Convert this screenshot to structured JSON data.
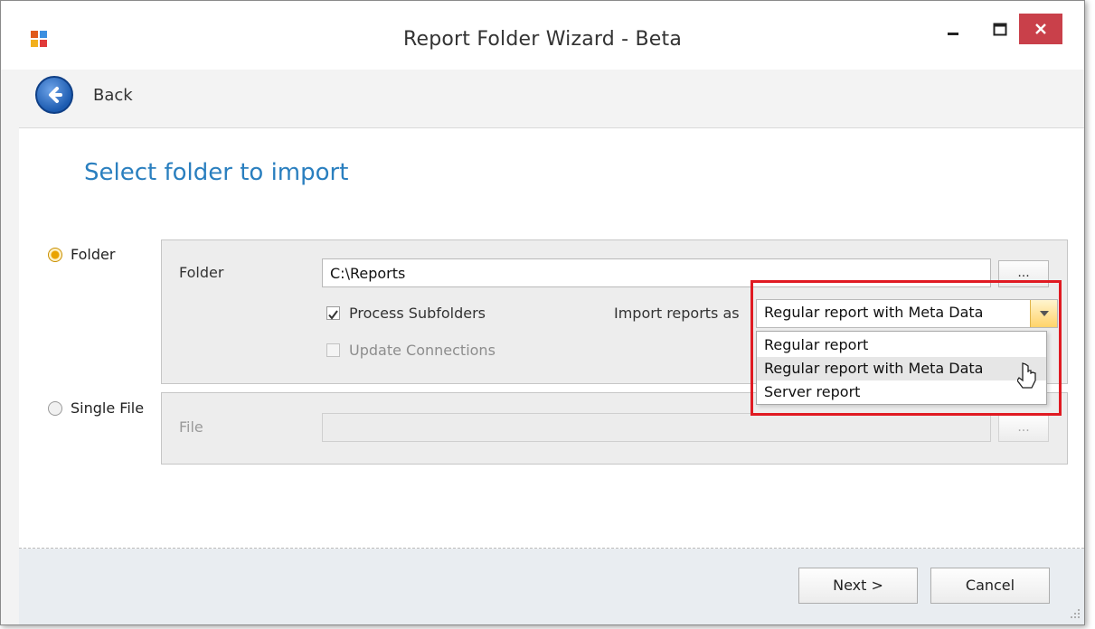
{
  "window": {
    "title": "Report Folder Wizard - Beta",
    "minimize_icon": "minimize-icon",
    "maximize_icon": "maximize-icon",
    "close_icon": "close-icon",
    "close_color": "#c9404a"
  },
  "nav": {
    "back_label": "Back"
  },
  "page": {
    "heading": "Select folder to import",
    "heading_color": "#2a7fbf"
  },
  "source_options": {
    "folder": {
      "label": "Folder",
      "checked": true
    },
    "single_file": {
      "label": "Single File",
      "checked": false
    }
  },
  "folder_group": {
    "folder_label": "Folder",
    "folder_value": "C:\\Reports",
    "browse_label": "...",
    "process_subfolders": {
      "label": "Process Subfolders",
      "checked": true
    },
    "update_connections": {
      "label": "Update Connections",
      "checked": false
    },
    "import_as_label": "Import reports as",
    "import_as_selected": "Regular report with Meta Data",
    "dropdown_options": [
      "Regular report",
      "Regular report with Meta Data",
      "Server report"
    ],
    "hovered_option": "Regular report with Meta Data"
  },
  "file_group": {
    "file_label": "File",
    "file_value": "",
    "browse_label": "..."
  },
  "footer": {
    "next_label": "Next >",
    "cancel_label": "Cancel"
  },
  "highlight_color": "#e01a22"
}
